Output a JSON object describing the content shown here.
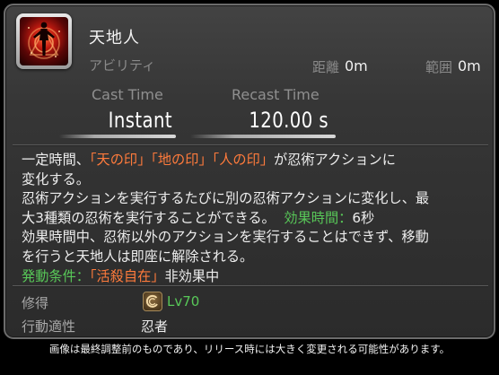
{
  "action": {
    "name": "天地人",
    "category": "アビリティ",
    "icon": "ten-chi-jin-icon",
    "distance_label": "距離",
    "distance_value": "0m",
    "radius_label": "範囲",
    "radius_value": "0m"
  },
  "timing": {
    "cast_label": "Cast Time",
    "cast_value": "Instant",
    "recast_label": "Recast Time",
    "recast_value": "120.00 s"
  },
  "description": {
    "l1_a": "一定時間、",
    "l1_b": "「天の印」「地の印」「人の印」",
    "l1_c": "が忍術アクションに",
    "l2": "変化する。",
    "l3": "忍術アクションを実行するたびに別の忍術アクションに変化し、最",
    "l4_a": "大3種類の忍術を実行することができる。",
    "l4_b": "効果時間：",
    "l4_c": "6秒",
    "l5": "効果時間中、忍術以外のアクションを実行することはできず、移動",
    "l6": "を行うと天地人は即座に解除される。",
    "l7_a": "発動条件：",
    "l7_b": "「活殺自在」",
    "l7_c": "非効果中"
  },
  "meta": {
    "acquired_label": "修得",
    "job_icon": "ninja-job-icon",
    "level": "Lv70",
    "class_label": "行動適性",
    "class_value": "忍者"
  },
  "footer": {
    "disclaimer": "画像は最終調整前のものであり、リリース時には大きく変更される可能性があります。"
  },
  "colors": {
    "highlight_orange": "#ff7b3c",
    "highlight_green": "#58c858",
    "panel_bg": "#333333"
  }
}
